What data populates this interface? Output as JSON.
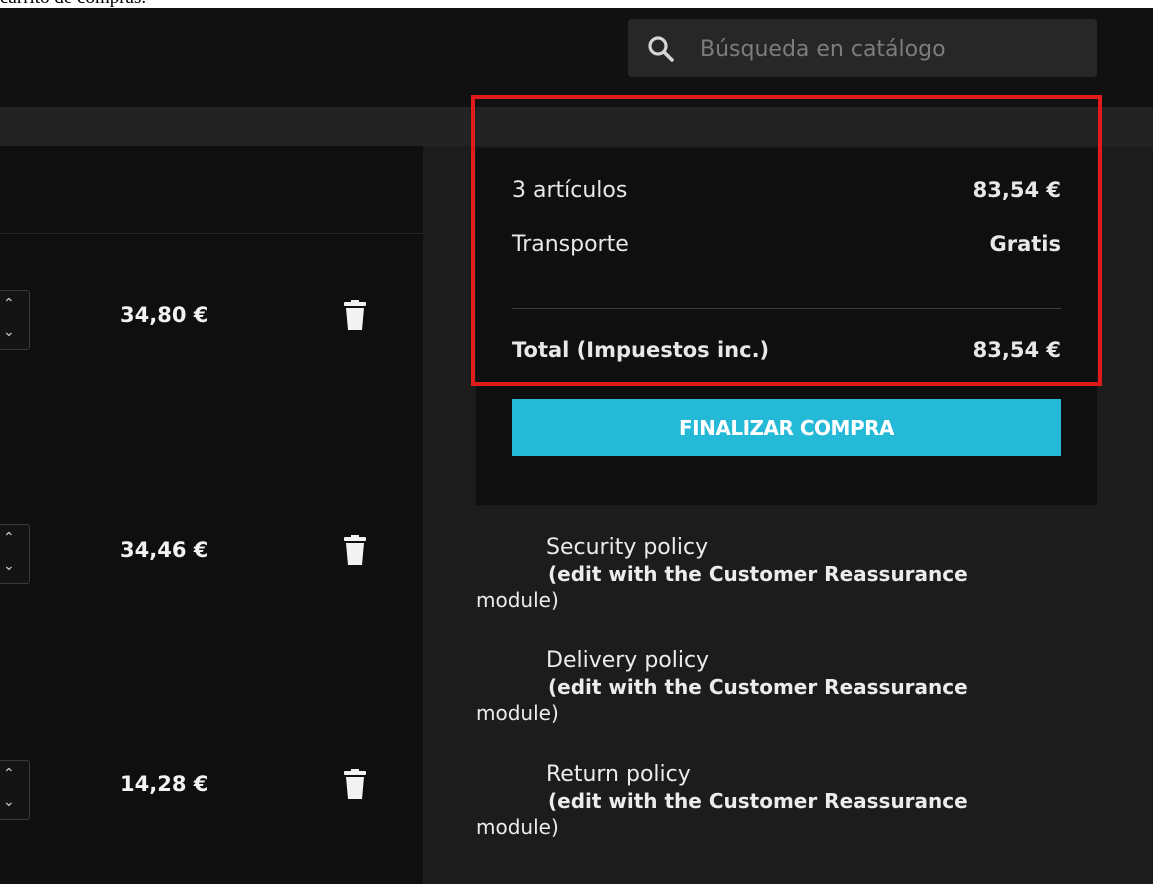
{
  "caption": "carrito de compras.",
  "search": {
    "placeholder": "Búsqueda en catálogo"
  },
  "cart": {
    "items": [
      {
        "price": "34,80 €"
      },
      {
        "price": "34,46 €"
      },
      {
        "price": "14,28 €"
      }
    ]
  },
  "summary": {
    "articles_label": "3 artículos",
    "articles_value": "83,54 €",
    "shipping_label": "Transporte",
    "shipping_value": "Gratis",
    "total_label": "Total (Impuestos inc.)",
    "total_value": "83,54 €",
    "checkout_label": "FINALIZAR COMPRA"
  },
  "reassurance": [
    {
      "title": "Security policy",
      "line1": "(edit with the Customer Reassurance",
      "line2": "module)"
    },
    {
      "title": "Delivery policy",
      "line1": "(edit with the Customer Reassurance",
      "line2": "module)"
    },
    {
      "title": "Return policy",
      "line1": "(edit with the Customer Reassurance",
      "line2": "module)"
    }
  ],
  "colors": {
    "accent": "#24b9d7",
    "highlight": "#e01b1b",
    "background": "#1c1c1c"
  }
}
